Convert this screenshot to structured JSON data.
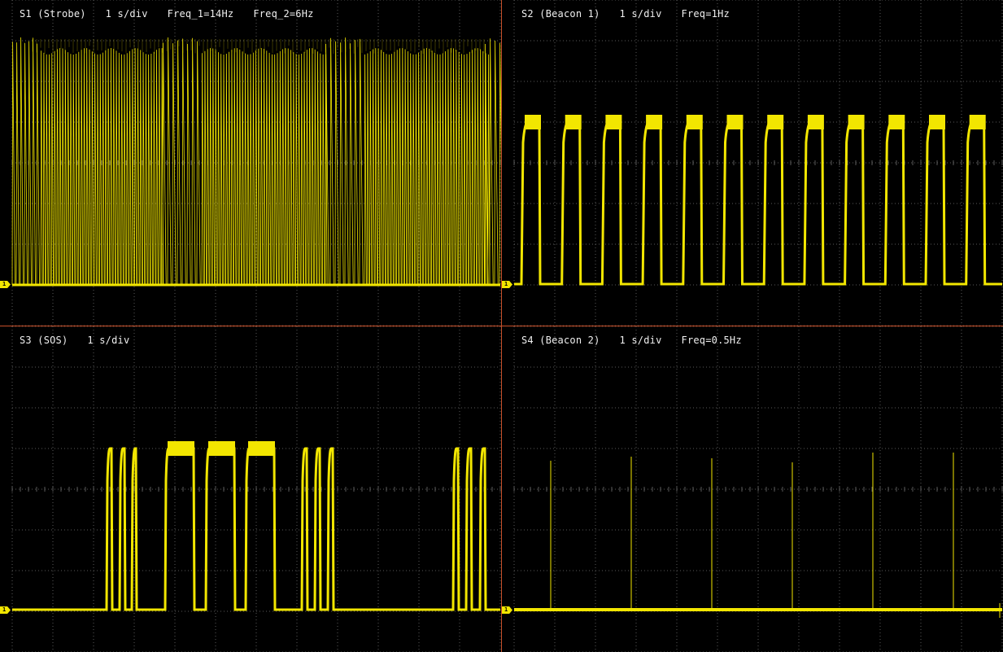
{
  "colors": {
    "background": "#000000",
    "grid": "#5a5a5a",
    "divider": "#c8502a",
    "trace": "#f2e600",
    "text": "#f0f0f0"
  },
  "panels": [
    {
      "id": "S1",
      "label": "S1 (Strobe)",
      "timebase": "1 s/div",
      "param_1": "Freq_1=14Hz",
      "param_2": "Freq_2=6Hz",
      "channel_marker": "1",
      "signal": "strobe",
      "freq_1_hz": 14,
      "freq_2_hz": 6
    },
    {
      "id": "S2",
      "label": "S2 (Beacon 1)",
      "timebase": "1 s/div",
      "param_1": "Freq=1Hz",
      "param_2": "",
      "channel_marker": "1",
      "signal": "beacon",
      "freq_hz": 1
    },
    {
      "id": "S3",
      "label": "S3 (SOS)",
      "timebase": "1 s/div",
      "param_1": "",
      "param_2": "",
      "channel_marker": "1",
      "signal": "sos"
    },
    {
      "id": "S4",
      "label": "S4 (Beacon 2)",
      "timebase": "1 s/div",
      "param_1": "Freq=0.5Hz",
      "param_2": "",
      "channel_marker": "1",
      "signal": "beacon2",
      "freq_hz": 0.5
    }
  ]
}
